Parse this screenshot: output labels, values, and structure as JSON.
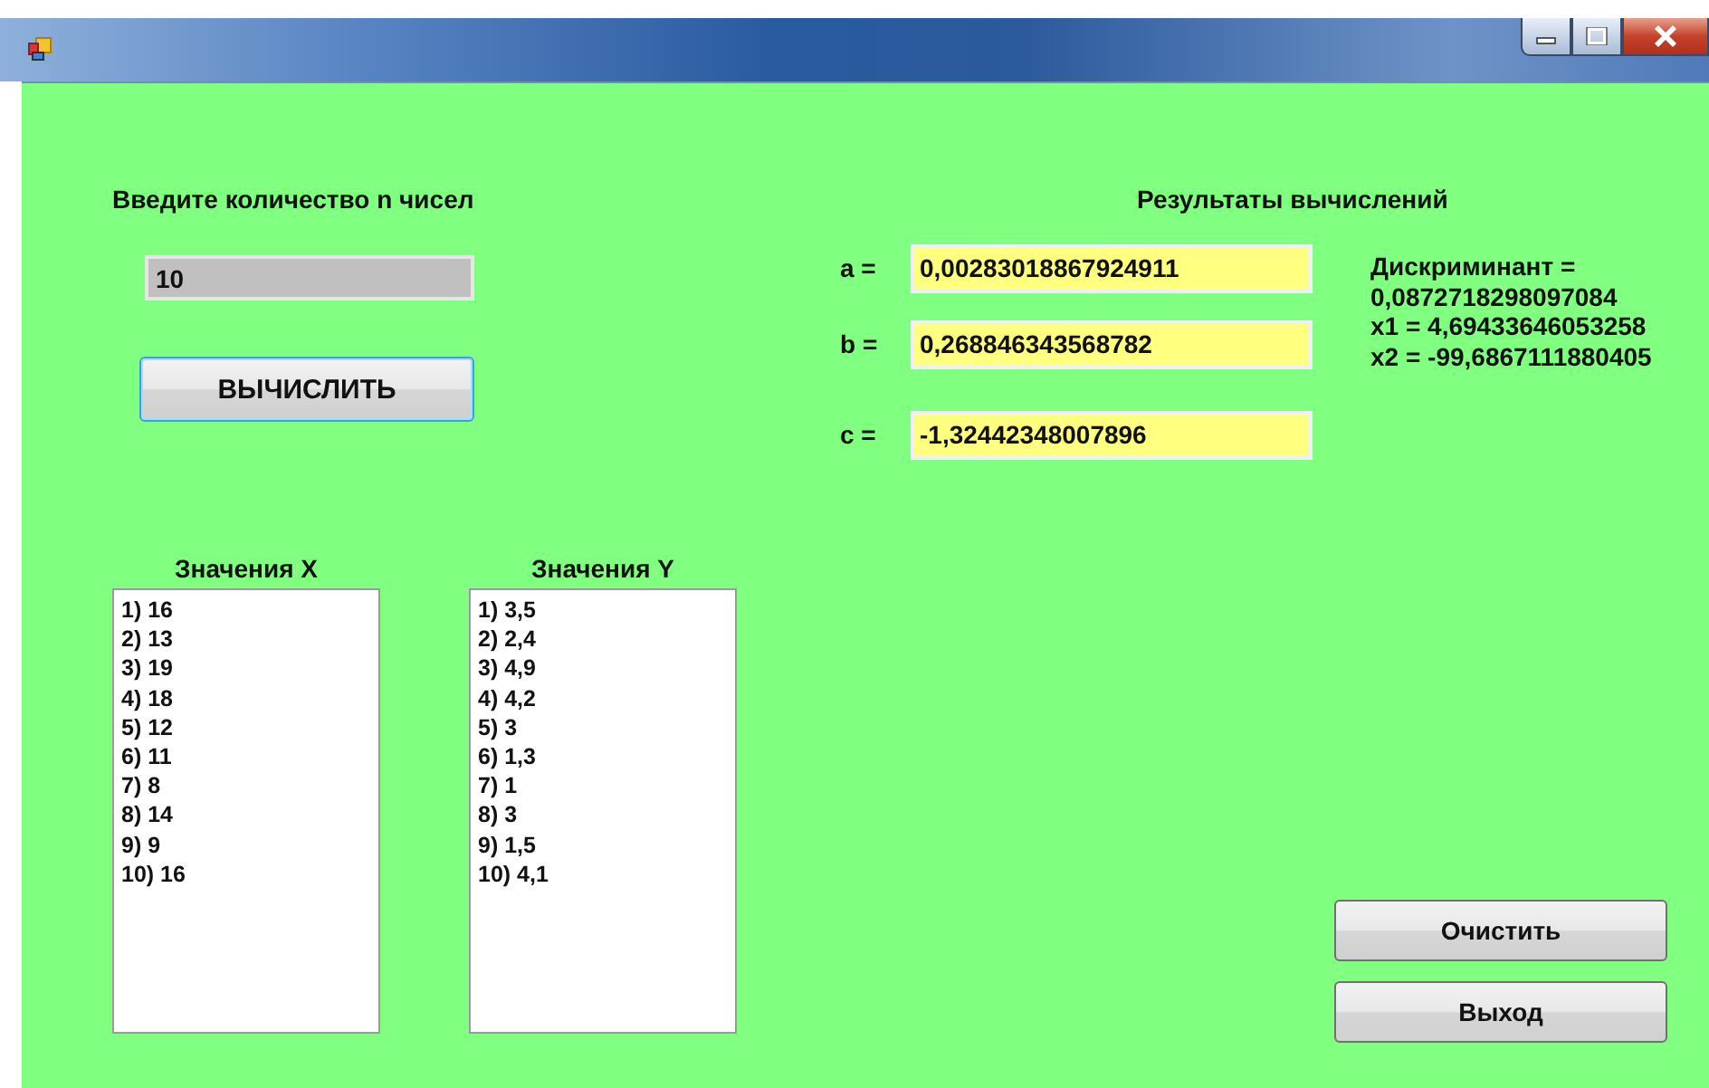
{
  "count_label": "Введите количество n чисел",
  "count_field": {
    "value": "10"
  },
  "compute_button": "ВЫЧИСЛИТЬ",
  "results_title": "Результаты вычислений",
  "coefficients": [
    {
      "label": "a =",
      "value": "0,00283018867924911"
    },
    {
      "label": "b =",
      "value": "0,268846343568782"
    },
    {
      "label": "c =",
      "value": "-1,32442348007896"
    }
  ],
  "results": [
    "Дискриминант =",
    "0,0872718298097084",
    "x1 = 4,69433646053258",
    "x2 = -99,6867111880405"
  ],
  "lists": [
    {
      "title": "Значения X",
      "items": [
        "1) 16",
        "2) 13",
        "3) 19",
        "4) 18",
        "5) 12",
        "6) 11",
        "7) 8",
        "8) 14",
        "9) 9",
        "10) 16"
      ]
    },
    {
      "title": "Значения Y",
      "items": [
        "1) 3,5",
        "2) 2,4",
        "3) 4,9",
        "4) 4,2",
        "5) 3",
        "6) 1,3",
        "7) 1",
        "8) 3",
        "9) 1,5",
        "10) 4,1"
      ]
    }
  ],
  "buttons": [
    "Очистить",
    "Выход"
  ]
}
